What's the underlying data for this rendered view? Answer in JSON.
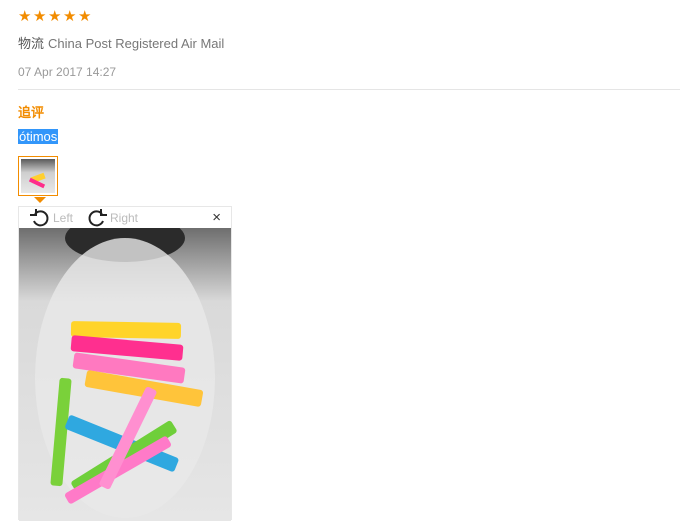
{
  "rating": {
    "stars": 5,
    "icon": "star-icon",
    "color": "#f28c00"
  },
  "logistics": {
    "label": "物流",
    "value": "China Post Registered Air Mail"
  },
  "date": "07 Apr 2017 14:27",
  "followup": {
    "title": "追评",
    "text": "ótimos"
  },
  "viewer": {
    "rotate_left_label": "Left",
    "rotate_right_label": "Right",
    "close_label": "×"
  }
}
